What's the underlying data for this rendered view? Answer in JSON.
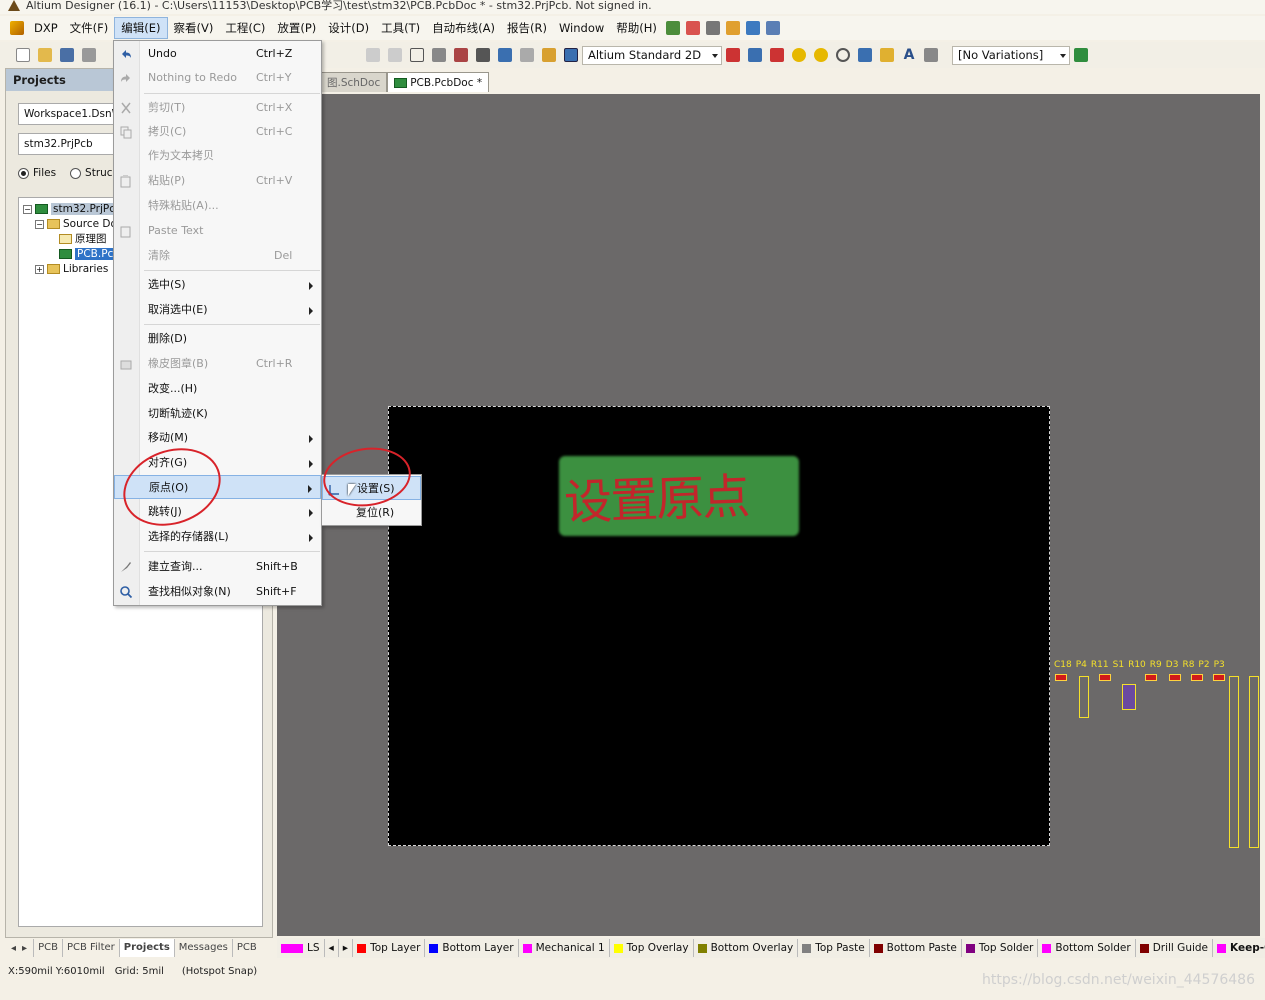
{
  "window": {
    "title": "Altium Designer (16.1) - C:\\Users\\11153\\Desktop\\PCB学习\\test\\stm32\\PCB.PcbDoc * - stm32.PrjPcb. Not signed in."
  },
  "menubar": {
    "items": [
      "DXP",
      "文件(F)",
      "编辑(E)",
      "察看(V)",
      "工程(C)",
      "放置(P)",
      "设计(D)",
      "工具(T)",
      "自动布线(A)",
      "报告(R)",
      "Window",
      "帮助(H)"
    ]
  },
  "toolbar": {
    "view_combo": "Altium Standard 2D",
    "variations_combo": "[No Variations]"
  },
  "panel": {
    "title": "Projects",
    "workspace": "Workspace1.DsnW",
    "project": "stm32.PrjPcb",
    "radio_files": "Files",
    "radio_structure": "Struc",
    "tree": {
      "root": "stm32.PrjPc",
      "source": "Source Do",
      "schdoc": "原理图",
      "pcbdoc": "PCB.Pcb",
      "libraries": "Libraries"
    }
  },
  "panel_tabs": [
    "PCB",
    "PCB Filter",
    "Projects",
    "Messages",
    "PCB"
  ],
  "doc_tabs": [
    "图.SchDoc",
    "PCB.PcbDoc *"
  ],
  "edit_menu": {
    "items": [
      {
        "label": "Undo",
        "shortcut": "Ctrl+Z",
        "disabled": false
      },
      {
        "label": "Nothing to Redo",
        "shortcut": "Ctrl+Y",
        "disabled": true
      },
      {
        "label": "剪切(T)",
        "shortcut": "Ctrl+X",
        "disabled": true
      },
      {
        "label": "拷贝(C)",
        "shortcut": "Ctrl+C",
        "disabled": true
      },
      {
        "label": "作为文本拷贝",
        "shortcut": "",
        "disabled": true
      },
      {
        "label": "粘贴(P)",
        "shortcut": "Ctrl+V",
        "disabled": true
      },
      {
        "label": "特殊粘贴(A)...",
        "shortcut": "",
        "disabled": true
      },
      {
        "label": "Paste Text",
        "shortcut": "",
        "disabled": true
      },
      {
        "label": "清除",
        "shortcut": "Del",
        "disabled": true
      },
      {
        "label": "选中(S)",
        "shortcut": "",
        "disabled": false
      },
      {
        "label": "取消选中(E)",
        "shortcut": "",
        "disabled": false
      },
      {
        "label": "删除(D)",
        "shortcut": "",
        "disabled": false
      },
      {
        "label": "橡皮图章(B)",
        "shortcut": "Ctrl+R",
        "disabled": true
      },
      {
        "label": "改变...(H)",
        "shortcut": "",
        "disabled": false
      },
      {
        "label": "切断轨迹(K)",
        "shortcut": "",
        "disabled": false
      },
      {
        "label": "移动(M)",
        "shortcut": "",
        "disabled": false
      },
      {
        "label": "对齐(G)",
        "shortcut": "",
        "disabled": false
      },
      {
        "label": "原点(O)",
        "shortcut": "",
        "disabled": false
      },
      {
        "label": "跳转(J)",
        "shortcut": "",
        "disabled": false
      },
      {
        "label": "选择的存储器(L)",
        "shortcut": "",
        "disabled": false
      },
      {
        "label": "建立查询...",
        "shortcut": "Shift+B",
        "disabled": false
      },
      {
        "label": "查找相似对象(N)",
        "shortcut": "Shift+F",
        "disabled": false
      }
    ]
  },
  "origin_submenu": {
    "items": [
      "设置(S)",
      "复位(R)"
    ]
  },
  "annotation": {
    "text": "设置原点"
  },
  "components": [
    "C18",
    "P4",
    "R11",
    "S1",
    "R10",
    "R9",
    "D3",
    "R8",
    "P2",
    "P3"
  ],
  "layers": [
    {
      "name": "LS",
      "color": "#ff00ff"
    },
    {
      "name": "Top Layer",
      "color": "#ff0000"
    },
    {
      "name": "Bottom Layer",
      "color": "#0000ff"
    },
    {
      "name": "Mechanical 1",
      "color": "#ff00ff"
    },
    {
      "name": "Top Overlay",
      "color": "#ffff00"
    },
    {
      "name": "Bottom Overlay",
      "color": "#808000"
    },
    {
      "name": "Top Paste",
      "color": "#808080"
    },
    {
      "name": "Bottom Paste",
      "color": "#800000"
    },
    {
      "name": "Top Solder",
      "color": "#800080"
    },
    {
      "name": "Bottom Solder",
      "color": "#ff00ff"
    },
    {
      "name": "Drill Guide",
      "color": "#800000"
    },
    {
      "name": "Keep-Ou",
      "color": "#ff00ff"
    }
  ],
  "status": {
    "coords": "X:590mil Y:6010mil",
    "grid": "Grid: 5mil",
    "snap": "(Hotspot Snap)"
  },
  "watermark": "https://blog.csdn.net/weixin_44576486",
  "colors": {
    "accent": "#cfe2f7",
    "annotation_circle": "#d8232a"
  }
}
